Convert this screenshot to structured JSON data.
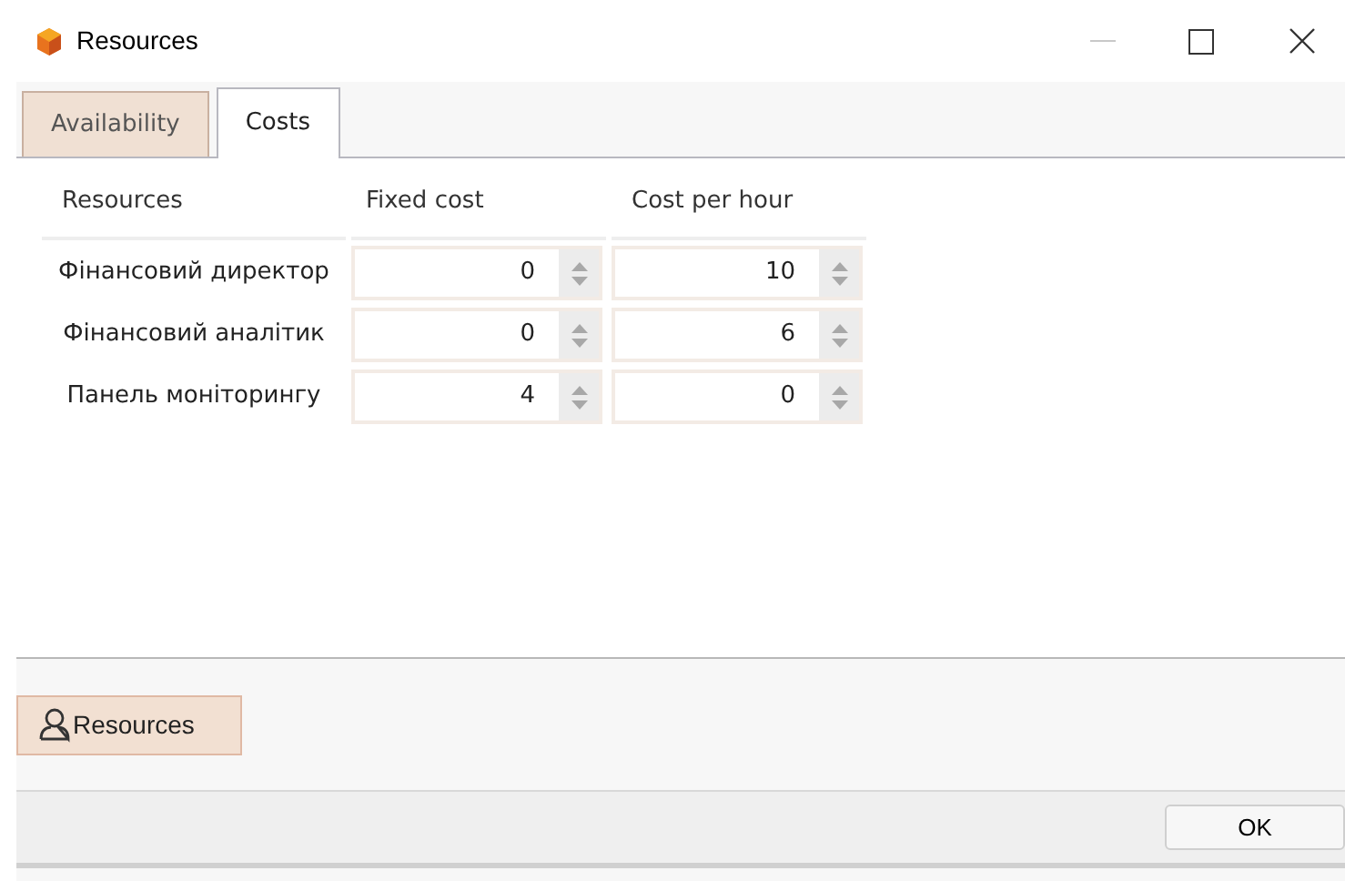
{
  "window": {
    "title": "Resources"
  },
  "tabs": [
    {
      "label": "Availability",
      "selected": false
    },
    {
      "label": "Costs",
      "selected": true
    }
  ],
  "table": {
    "columns": [
      "Resources",
      "Fixed cost",
      "Cost per hour"
    ],
    "rows": [
      {
        "resource": "Фінансовий директор",
        "fixed_cost": "0",
        "cost_per_hour": "10"
      },
      {
        "resource": "Фінансовий аналітик",
        "fixed_cost": "0",
        "cost_per_hour": "6"
      },
      {
        "resource": "Панель моніторингу",
        "fixed_cost": "4",
        "cost_per_hour": "0"
      }
    ]
  },
  "resources_button": "Resources",
  "ok_button": "OK"
}
